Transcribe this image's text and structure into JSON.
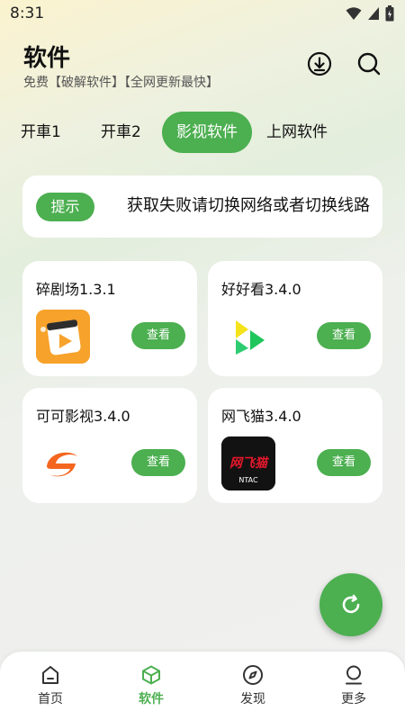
{
  "status": {
    "time": "8:31"
  },
  "header": {
    "title": "软件",
    "subtitle": "免费【破解软件】【全网更新最快】",
    "download_icon": "download-icon",
    "search_icon": "search-icon"
  },
  "tabs": [
    {
      "label": "开車1",
      "active": false
    },
    {
      "label": "开車2",
      "active": false
    },
    {
      "label": "影视软件",
      "active": true
    },
    {
      "label": "上网软件",
      "active": false
    }
  ],
  "notice": {
    "badge": "提示",
    "text": "获取失败请切换网络或者切换线路"
  },
  "apps": [
    {
      "name": "碎剧场1.3.1",
      "button": "查看",
      "icon": "play-film-icon"
    },
    {
      "name": "好好看3.4.0",
      "button": "查看",
      "icon": "play-triangle-icon"
    },
    {
      "name": "可可影视3.4.0",
      "button": "查看",
      "icon": "swirl-logo-icon"
    },
    {
      "name": "网飞猫3.4.0",
      "button": "查看",
      "icon": "netflix-cat-logo",
      "icon_text": "网飞猫",
      "icon_subtext": "NTAC"
    }
  ],
  "fab": {
    "icon": "refresh-icon"
  },
  "bottom_nav": [
    {
      "label": "首页",
      "icon": "home-icon",
      "active": false
    },
    {
      "label": "软件",
      "icon": "cube-icon",
      "active": true
    },
    {
      "label": "发现",
      "icon": "compass-icon",
      "active": false
    },
    {
      "label": "更多",
      "icon": "person-icon",
      "active": false
    }
  ],
  "colors": {
    "accent": "#4caf50"
  }
}
